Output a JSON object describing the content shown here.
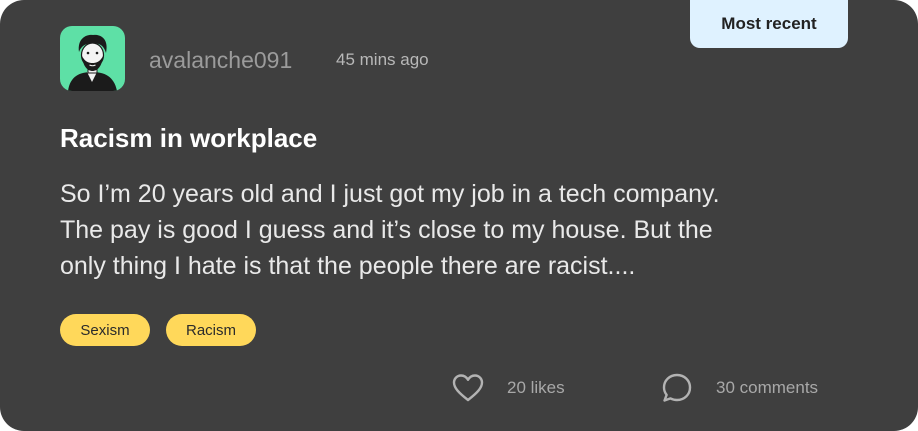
{
  "filter": {
    "active_label": "Most recent"
  },
  "post": {
    "author": {
      "username": "avalanche091",
      "avatar_icon": "bearded-man-avatar-icon"
    },
    "posted_ago": "45 mins ago",
    "title": "Racism in workplace",
    "body_lines": [
      "So I’m 20 years old and I just got my job in a tech company.",
      "The pay is good I guess and it’s close to my house. But the",
      "only thing I hate is that the people there are racist...."
    ],
    "tags": [
      "Sexism",
      "Racism"
    ],
    "likes_label": "20 likes",
    "comments_label": "30 comments"
  },
  "colors": {
    "card_bg": "#3f3f3f",
    "badge_bg": "#dff2ff",
    "tag_bg": "#ffd85a",
    "avatar_bg": "#5ee0a6"
  },
  "icons": {
    "like": "heart-icon",
    "comment": "speech-bubble-icon"
  }
}
